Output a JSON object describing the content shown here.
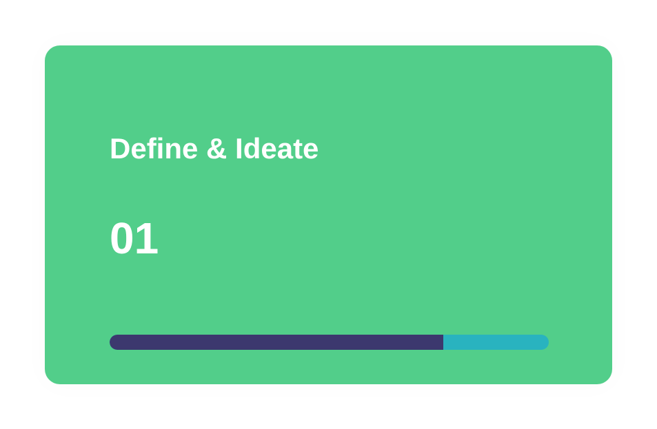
{
  "card": {
    "title": "Define & Ideate",
    "number": "01",
    "progress": 0.76
  },
  "colors": {
    "card_background": "#52CE8A",
    "progress_fill": "#3C386E",
    "progress_track": "#29B3BF",
    "text": "#FFFFFF"
  }
}
